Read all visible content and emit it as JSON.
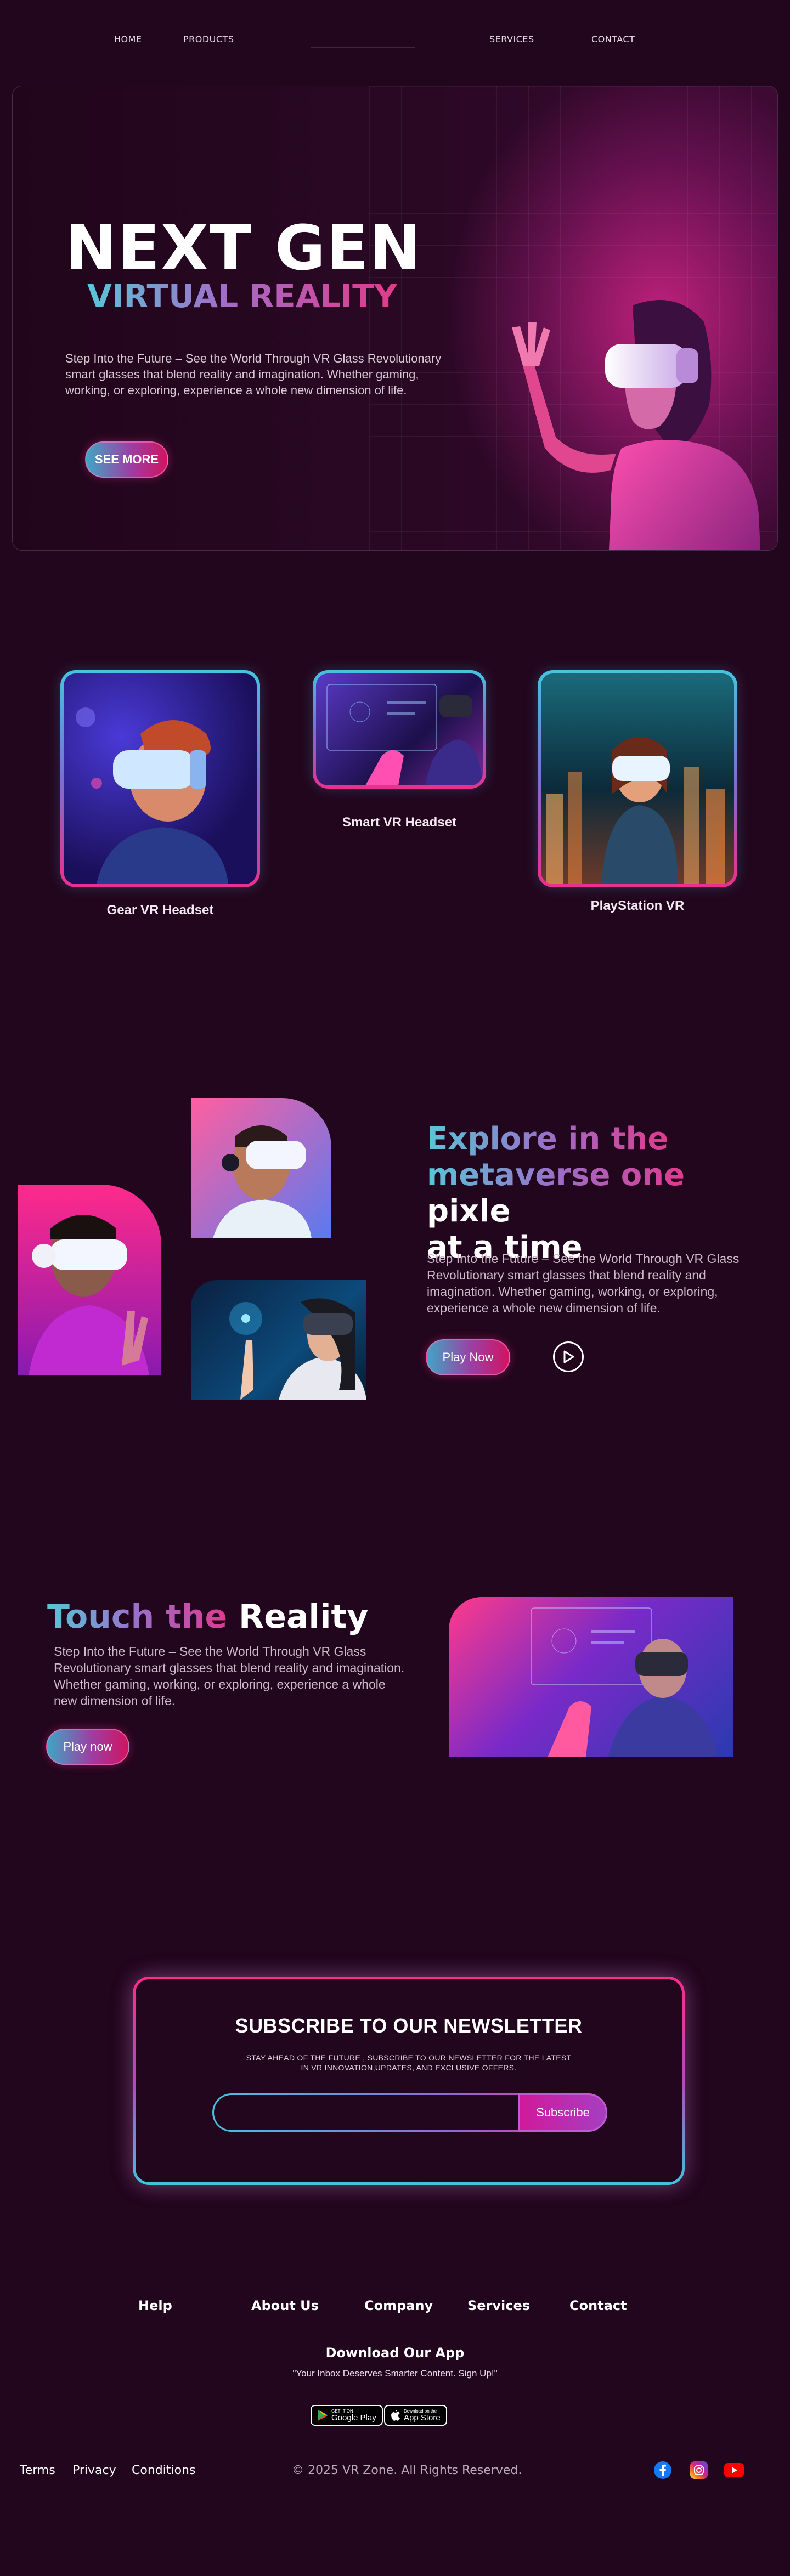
{
  "nav": {
    "home": "HOME",
    "products": "PRODUCTS",
    "services": "SERVICES",
    "contact": "CONTACT"
  },
  "hero": {
    "title": "NEXT GEN",
    "subtitle": "VIRTUAL REALITY",
    "text": "Step Into the Future – See the World Through VR Glass Revolutionary smart glasses that blend reality and imagination. Whether gaming, working, or exploring, experience a whole new dimension of life.",
    "cta": "SEE MORE"
  },
  "products": [
    {
      "label": "Gear VR Headset"
    },
    {
      "label": "Smart VR Headset"
    },
    {
      "label": "PlayStation VR"
    }
  ],
  "explore": {
    "title_part1": "Explore in the",
    "title_part2": "metaverse one",
    "title_part3": " pixle",
    "title_part4": "at a time",
    "text": "Step Into the Future – See the World Through VR Glass Revolutionary smart glasses that blend reality and imagination. Whether gaming, working, or exploring, experience a whole new dimension of life.",
    "cta": "Play Now"
  },
  "touch": {
    "title_grad": "Touch the",
    "title_white": " Reality",
    "text": "Step Into the Future – See the World Through VR Glass Revolutionary smart glasses that blend reality and imagination. Whether gaming, working, or exploring, experience a whole new dimension of life.",
    "cta": "Play now"
  },
  "newsletter": {
    "title": "SUBSCRIBE TO OUR NEWSLETTER",
    "text": "STAY AHEAD OF THE FUTURE , SUBSCRIBE TO OUR NEWSLETTER FOR THE LATEST IN VR INNOVATION,UPDATES, AND EXCLUSIVE OFFERS.",
    "input_value": "",
    "button": "Subscribe"
  },
  "footer": {
    "links": [
      "Help",
      "About Us",
      "Company",
      "Services",
      "Contact"
    ],
    "app_title": "Download Our App",
    "app_tagline": "\"Your Inbox Deserves Smarter Content. Sign Up!\"",
    "google_play_small": "GET IT ON",
    "google_play": "Google Play",
    "app_store_small": "Download on the",
    "app_store": "App Store",
    "bottom_links": [
      "Terms",
      "Privacy",
      "Conditions"
    ],
    "copyright": "© 2025 VR Zone. All Rights Reserved.",
    "socials": [
      "facebook-icon",
      "instagram-icon",
      "youtube-icon"
    ]
  },
  "colors": {
    "background": "#22061d",
    "accent_cyan": "#46c3df",
    "accent_pink": "#ec2f8d"
  }
}
